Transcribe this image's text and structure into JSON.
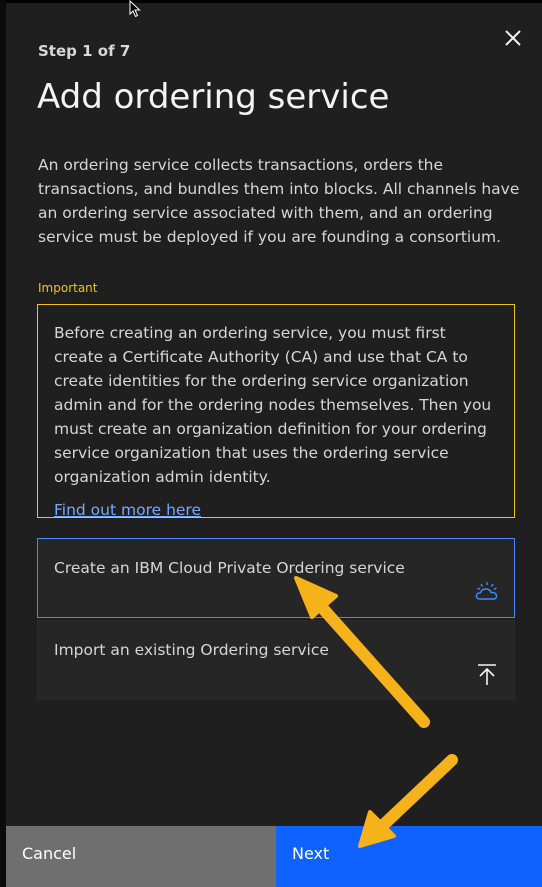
{
  "panel": {
    "step": "Step 1 of 7",
    "title": "Add ordering service",
    "description": "An ordering service collects transactions, orders the transactions, and bundles them into blocks. All channels have an ordering service associated with them, and an ordering service must be deployed if you are founding a consortium."
  },
  "important": {
    "label": "Important",
    "text": "Before creating an ordering service, you must first create a Certificate Authority (CA) and use that CA to create identities for the ordering service organization admin and for the ordering nodes themselves. Then you must create an organization definition for your ordering service organization that uses the ordering service organization admin identity.",
    "link": "Find out more here"
  },
  "options": [
    {
      "label": "Create an IBM Cloud Private Ordering service",
      "icon": "cloud-icon"
    },
    {
      "label": "Import an existing Ordering service",
      "icon": "upload-icon"
    }
  ],
  "footer": {
    "cancel": "Cancel",
    "next": "Next"
  },
  "colors": {
    "accent": "#0f62fe",
    "warning": "#f1c21b",
    "link": "#78a9ff",
    "annotation": "#f5b21b"
  }
}
